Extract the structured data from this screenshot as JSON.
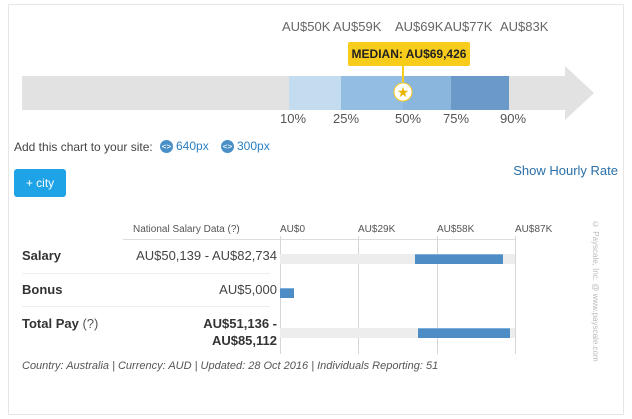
{
  "range_chart": {
    "top_labels": [
      "AU$50K",
      "AU$59K",
      "AU$69K",
      "AU$77K",
      "AU$83K"
    ],
    "percentile_labels": [
      "10%",
      "25%",
      "50%",
      "75%",
      "90%"
    ],
    "median_label": "MEDIAN: AU$69,426",
    "colors": {
      "track": "#e2e2e2",
      "band_10_25": "#c3dcef",
      "band_25_50": "#93bde2",
      "band_50_75": "#8ab5dd",
      "band_75_90": "#6b9ac8",
      "median_box": "#f8cc1b"
    }
  },
  "embed": {
    "prompt": "Add this chart to your site:",
    "size_640": "640px",
    "size_300": "300px"
  },
  "city_button": "+ city",
  "hourly_link": "Show Hourly Rate",
  "table": {
    "col_header": "National Salary Data",
    "col_header_help": "(?)",
    "axis_ticks": [
      "AU$0",
      "AU$29K",
      "AU$58K",
      "AU$87K"
    ],
    "axis_max": 87000,
    "rows": [
      {
        "label": "Salary",
        "help": "",
        "value": "AU$50,139 - AU$82,734",
        "value_line2": "",
        "low": 50139,
        "high": 82734
      },
      {
        "label": "Bonus",
        "help": "",
        "value": "AU$5,000",
        "value_line2": "",
        "low": 0,
        "high": 5000
      },
      {
        "label": "Total Pay",
        "help": "(?)",
        "value": "AU$51,136 -",
        "value_line2": "AU$85,112",
        "low": 51136,
        "high": 85112
      }
    ]
  },
  "footer": "Country: Australia | Currency: AUD | Updated: 28 Oct 2016 | Individuals Reporting: 51",
  "watermark": "© Payscale, Inc. @ www.payscale.com"
}
